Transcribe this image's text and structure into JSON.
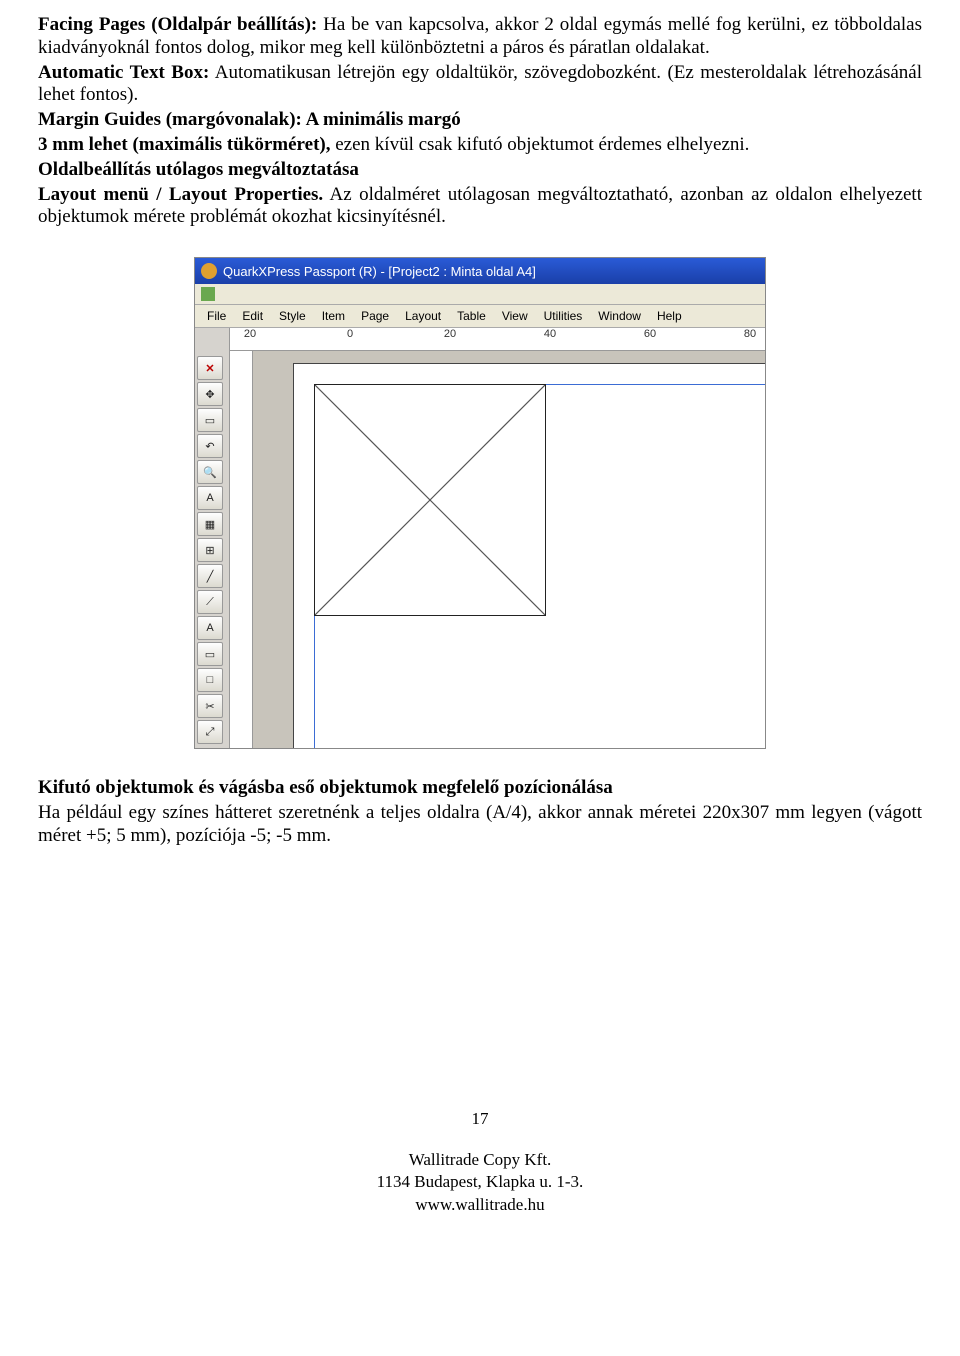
{
  "doc": {
    "p1_b_lead": "Facing Pages (Oldalpár beállítás):",
    "p1_rest": " Ha be van kapcsolva, akkor 2 oldal egymás mellé fog kerülni, ez többoldalas kiadványoknál fontos dolog, mikor meg kell különböztetni a páros és páratlan oldalakat.",
    "p2_b_lead": "Automatic Text Box:",
    "p2_rest": " Automatikusan létrejön egy oldaltükör, szövegdobozként. (Ez mesteroldalak létrehozásánál lehet fontos).",
    "p3_b_lead": "Margin Guides (margóvonalak): A minimális margó",
    "p4_b": "3 mm lehet (maximális tükörméret),",
    "p4_rest": " ezen kívül csak kifutó objektumot érdemes elhelyezni.",
    "p5_b": "Oldalbeállítás utólagos megváltoztatása",
    "p6_b_lead": "Layout menü / Layout Properties.",
    "p6_rest": " Az oldalméret utólagosan megváltoztatható, azonban az oldalon elhelyezett objektumok mérete problémát okozhat kicsinyítésnél.",
    "p7_b": "Kifutó objektumok és vágásba eső objektumok megfelelő pozícionálása",
    "p8": "Ha például egy színes hátteret szeretnénk a teljes oldalra (A/4), akkor annak méretei 220x307 mm legyen (vágott méret +5; 5 mm), pozíciója -5; -5 mm."
  },
  "qxp": {
    "title": "QuarkXPress Passport (R) - [Project2 : Minta oldal A4]",
    "menus": [
      "File",
      "Edit",
      "Style",
      "Item",
      "Page",
      "Layout",
      "Table",
      "View",
      "Utilities",
      "Window",
      "Help"
    ],
    "ruler_labels": [
      "20",
      "0",
      "20",
      "40",
      "60",
      "80"
    ],
    "tool_glyphs": [
      "✕",
      "✥",
      "▭",
      "↶",
      "🔍",
      "A",
      "▦",
      "⊞",
      "╱",
      "⟋",
      "A",
      "▭",
      "□",
      "✂",
      "⤢"
    ]
  },
  "footer": {
    "page": "17",
    "l1": "Wallitrade Copy Kft.",
    "l2": "1134 Budapest, Klapka u. 1-3.",
    "l3": "www.wallitrade.hu"
  }
}
